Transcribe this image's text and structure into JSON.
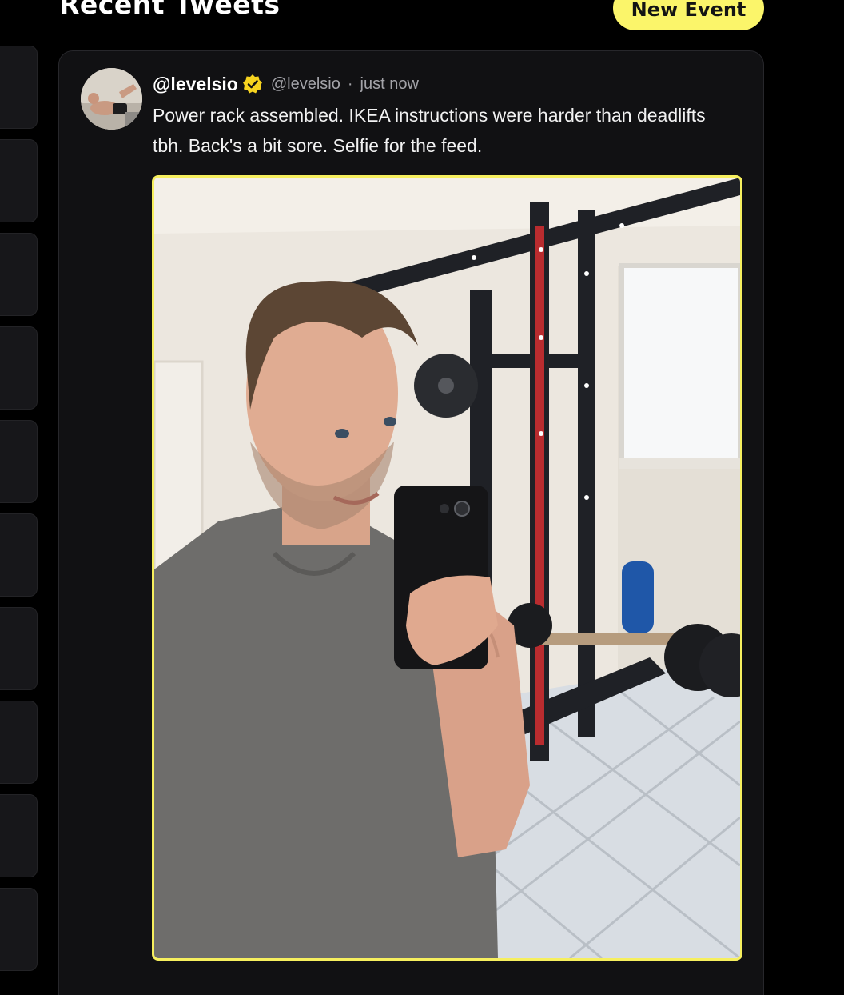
{
  "header": {
    "section_title": "Recent Tweets",
    "new_event_label": "New Event"
  },
  "sidebar": {
    "cards": [
      {},
      {},
      {},
      {},
      {},
      {},
      {},
      {},
      {},
      {}
    ]
  },
  "tweet": {
    "display_name": "@levelsio",
    "handle": "@levelsio",
    "separator": "·",
    "time": "just now",
    "text": "Power rack assembled. IKEA instructions were harder than deadlifts tbh. Back's a bit sore. Selfie for the feed.",
    "verified": true,
    "media_label": "mirror selfie in home gym with power rack"
  },
  "colors": {
    "background": "#000000",
    "card": "#111113",
    "accent_yellow": "#fbf56a",
    "muted_text": "#a3a3a8"
  }
}
